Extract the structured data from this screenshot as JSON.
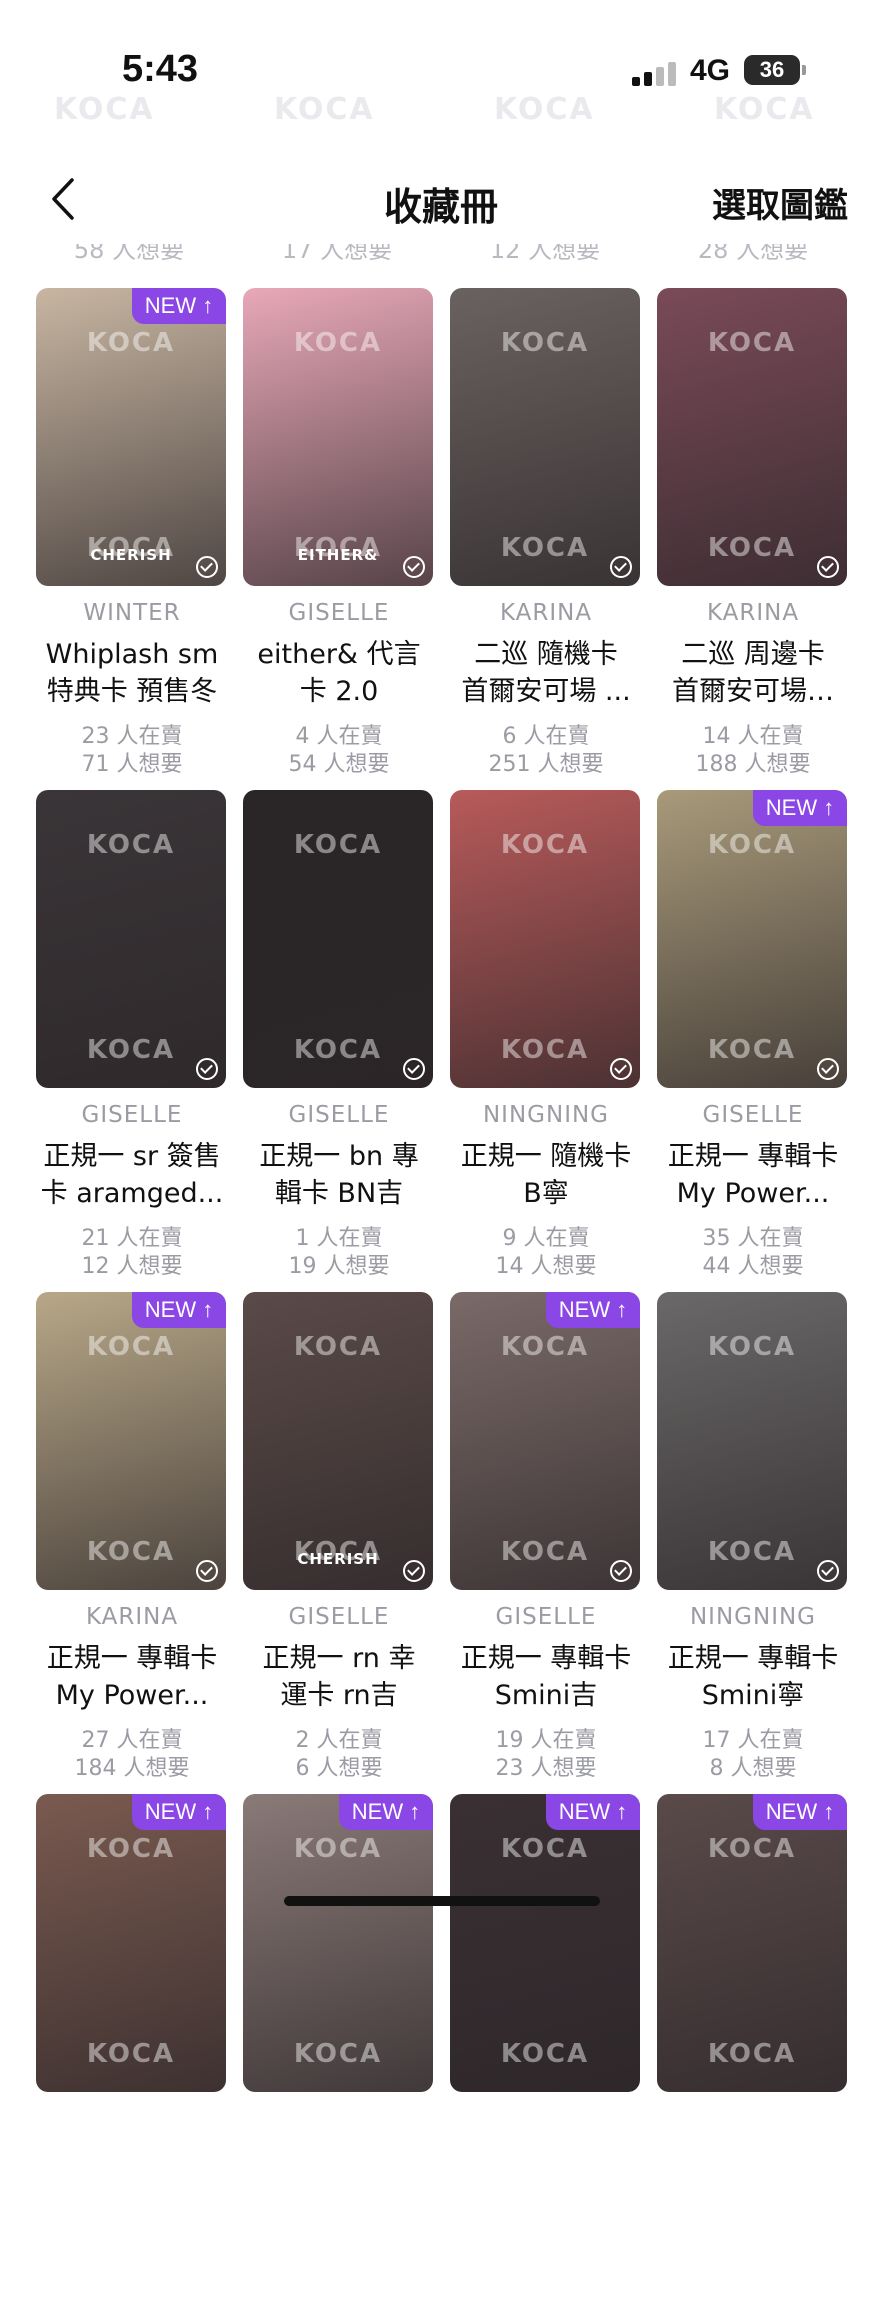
{
  "status_bar": {
    "time": "5:43",
    "network": "4G",
    "battery": "36"
  },
  "watermark": "KOCA",
  "nav": {
    "title": "收藏冊",
    "action": "選取圖鑑"
  },
  "previous_row_counts": [
    "58 人想要",
    "17 人想要",
    "12 人想要",
    "28 人想要"
  ],
  "cards": [
    {
      "artist": "WINTER",
      "title": "Whiplash sm\n特典卡 預售冬",
      "selling": "23 人在賣",
      "wanting": "71 人想要",
      "is_new": true,
      "new_label": "NEW ↑",
      "caption": "CHERISH",
      "tint": "#c8b6a2"
    },
    {
      "artist": "GISELLE",
      "title": "either& 代言\n卡 2.0",
      "selling": "4 人在賣",
      "wanting": "54 人想要",
      "is_new": false,
      "caption": "EITHER&",
      "tint": "#e8a8b8"
    },
    {
      "artist": "KARINA",
      "title": "二巡 隨機卡\n首爾安可場 ...",
      "selling": "6 人在賣",
      "wanting": "251 人想要",
      "is_new": false,
      "caption": "",
      "tint": "#6a6260"
    },
    {
      "artist": "KARINA",
      "title": "二巡 周邊卡\n首爾安可場…",
      "selling": "14 人在賣",
      "wanting": "188 人想要",
      "is_new": false,
      "caption": "",
      "tint": "#7a4a58"
    },
    {
      "artist": "GISELLE",
      "title": "正規一 sr 簽售\n卡 aramged...",
      "selling": "21 人在賣",
      "wanting": "12 人想要",
      "is_new": false,
      "caption": "",
      "tint": "#3a3538"
    },
    {
      "artist": "GISELLE",
      "title": "正規一 bn 專\n輯卡 BN吉",
      "selling": "1 人在賣",
      "wanting": "19 人想要",
      "is_new": false,
      "caption": "",
      "tint": "#2a2628"
    },
    {
      "artist": "NINGNING",
      "title": "正規一 隨機卡\nB寧",
      "selling": "9 人在賣",
      "wanting": "14 人想要",
      "is_new": false,
      "caption": "",
      "tint": "#b85a5a"
    },
    {
      "artist": "GISELLE",
      "title": "正規一 專輯卡\nMy Power...",
      "selling": "35 人在賣",
      "wanting": "44 人想要",
      "is_new": true,
      "new_label": "NEW ↑",
      "caption": "",
      "tint": "#a89a7a"
    },
    {
      "artist": "KARINA",
      "title": "正規一 專輯卡\nMy Power...",
      "selling": "27 人在賣",
      "wanting": "184 人想要",
      "is_new": true,
      "new_label": "NEW ↑",
      "caption": "",
      "tint": "#b8a888"
    },
    {
      "artist": "GISELLE",
      "title": "正規一 rn 幸\n運卡 rn吉",
      "selling": "2 人在賣",
      "wanting": "6 人想要",
      "is_new": false,
      "caption": "CHERISH",
      "tint": "#5a4a48"
    },
    {
      "artist": "GISELLE",
      "title": "正規一 專輯卡\nSmini吉",
      "selling": "19 人在賣",
      "wanting": "23 人想要",
      "is_new": true,
      "new_label": "NEW ↑",
      "caption": "",
      "tint": "#7a6a68"
    },
    {
      "artist": "NINGNING",
      "title": "正規一 專輯卡\nSmini寧",
      "selling": "17 人在賣",
      "wanting": "8 人想要",
      "is_new": false,
      "caption": "",
      "tint": "#6a6868"
    },
    {
      "artist": "",
      "title": "",
      "selling": "",
      "wanting": "",
      "is_new": true,
      "new_label": "NEW ↑",
      "caption": "",
      "tint": "#7a5a50"
    },
    {
      "artist": "",
      "title": "",
      "selling": "",
      "wanting": "",
      "is_new": true,
      "new_label": "NEW ↑",
      "caption": "",
      "tint": "#8a7a78"
    },
    {
      "artist": "",
      "title": "",
      "selling": "",
      "wanting": "",
      "is_new": true,
      "new_label": "NEW ↑",
      "caption": "",
      "tint": "#3a3034"
    },
    {
      "artist": "",
      "title": "",
      "selling": "",
      "wanting": "",
      "is_new": true,
      "new_label": "NEW ↑",
      "caption": "",
      "tint": "#5a4a4a"
    }
  ]
}
